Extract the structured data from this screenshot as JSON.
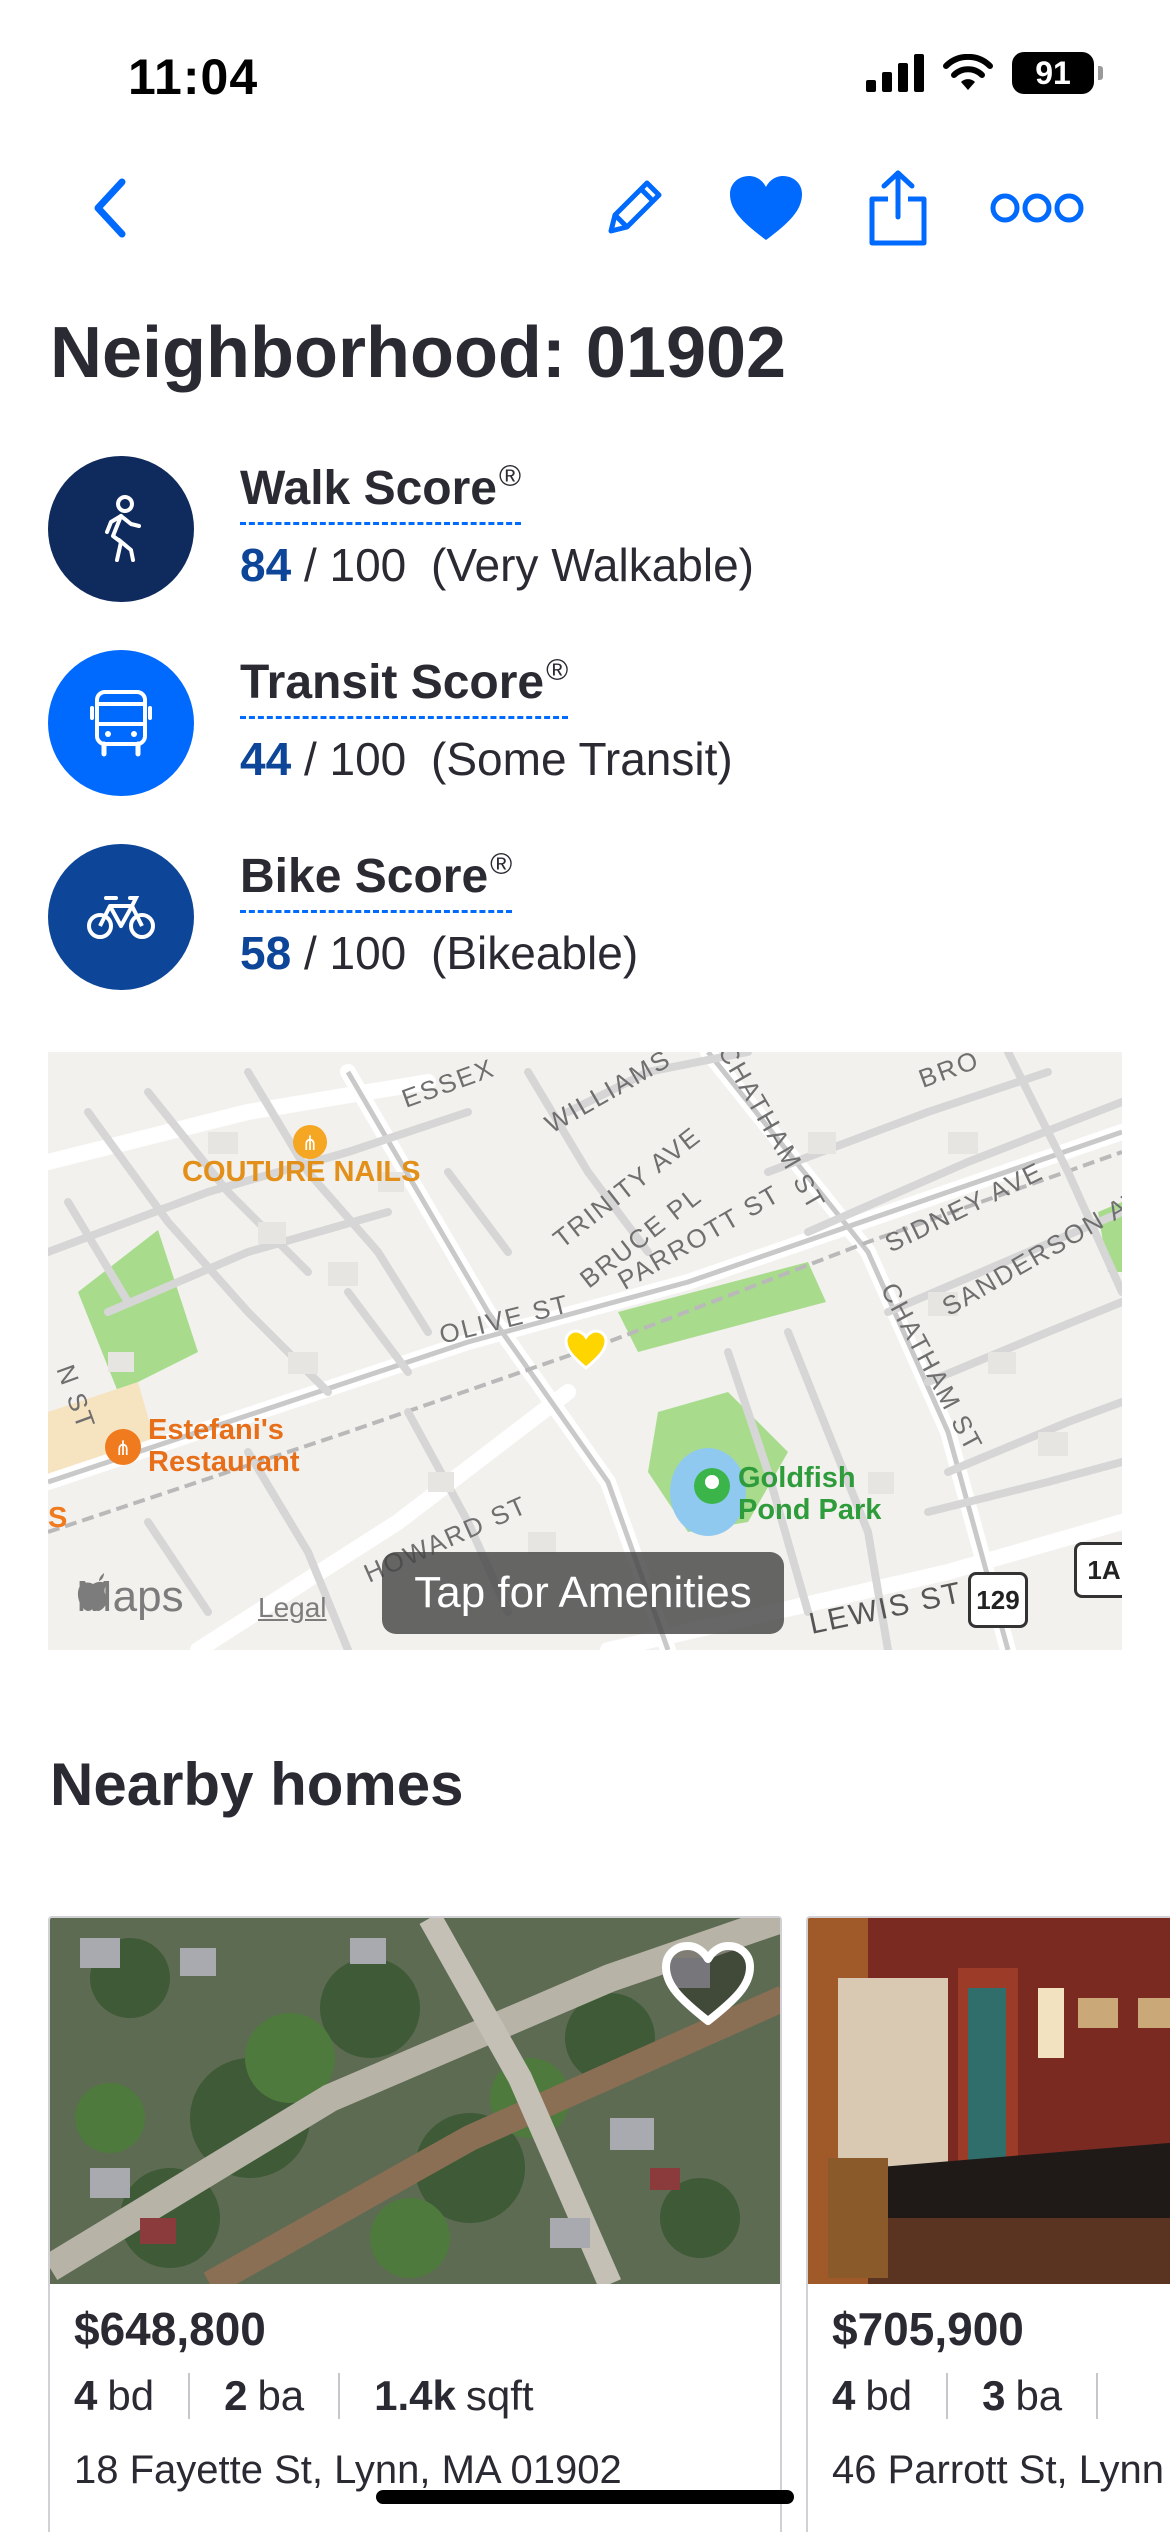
{
  "status_bar": {
    "time": "11:04",
    "battery": "91"
  },
  "nav": {
    "icons": [
      "back-chevron-icon",
      "pencil-icon",
      "heart-icon",
      "share-icon",
      "more-icon"
    ],
    "accent": "#006aff"
  },
  "title": "Neighborhood: 01902",
  "scores": [
    {
      "name": "Walk Score",
      "mark": "®",
      "value": "84",
      "max": "/ 100",
      "desc": "(Very Walkable)",
      "icon": "walking-person-icon",
      "color": "#0f2a5c"
    },
    {
      "name": "Transit Score",
      "mark": "®",
      "value": "44",
      "max": "/ 100",
      "desc": "(Some Transit)",
      "icon": "bus-icon",
      "color": "#006aff"
    },
    {
      "name": "Bike Score",
      "mark": "®",
      "value": "58",
      "max": "/ 100",
      "desc": "(Bikeable)",
      "icon": "bicycle-icon",
      "color": "#0d4599"
    }
  ],
  "map": {
    "streets": [
      "ESSEX",
      "WILLIAMS",
      "CHATHAM ST",
      "BRO",
      "TRINITY AVE",
      "BRUCE PL",
      "PARROTT ST",
      "SIDNEY AVE",
      "SANDERSON AVE",
      "OLIVE ST",
      "CHATHAM ST",
      "N ST",
      "HOWARD ST",
      "LEWIS ST",
      "S"
    ],
    "pois": {
      "nails": "COUTURE NAILS",
      "restaurant_line1": "Estefani's",
      "restaurant_line2": "Restaurant",
      "park_line1": "Goldfish",
      "park_line2": "Pond Park"
    },
    "brand": "Maps",
    "legal": "Legal",
    "button": "Tap for Amenities",
    "shields": [
      "129",
      "1A"
    ]
  },
  "nearby_title": "Nearby homes",
  "homes": [
    {
      "price": "$648,800",
      "beds": "4",
      "beds_unit": "bd",
      "baths": "2",
      "baths_unit": "ba",
      "sqft": "1.4k",
      "sqft_unit": "sqft",
      "address": "18 Fayette St, Lynn, MA 01902"
    },
    {
      "price": "$705,900",
      "beds": "4",
      "beds_unit": "bd",
      "baths": "3",
      "baths_unit": "ba",
      "address": "46 Parrott St, Lynn"
    }
  ]
}
